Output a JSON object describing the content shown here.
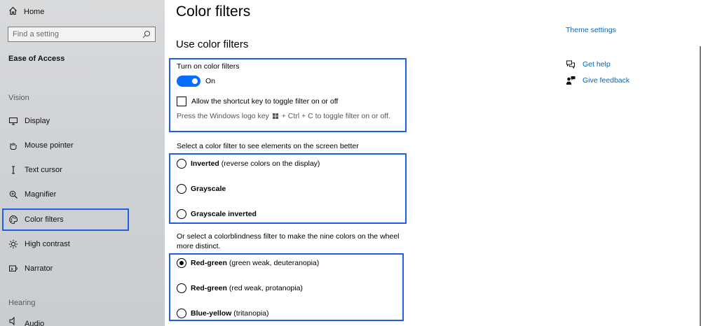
{
  "sidebar": {
    "home_label": "Home",
    "search_placeholder": "Find a setting",
    "section_title": "Ease of Access",
    "group_vision": "Vision",
    "items": [
      {
        "label": "Display",
        "icon": "monitor-icon"
      },
      {
        "label": "Mouse pointer",
        "icon": "mouse-pointer-icon"
      },
      {
        "label": "Text cursor",
        "icon": "text-cursor-icon"
      },
      {
        "label": "Magnifier",
        "icon": "magnifier-icon"
      },
      {
        "label": "Color filters",
        "icon": "palette-icon",
        "active": true
      },
      {
        "label": "High contrast",
        "icon": "sun-icon"
      },
      {
        "label": "Narrator",
        "icon": "narrator-icon"
      }
    ],
    "group_hearing": "Hearing",
    "partial_item": "Audio"
  },
  "main": {
    "title": "Color filters",
    "subtitle": "Use color filters",
    "turn_on_label": "Turn on color filters",
    "toggle_state": "On",
    "shortcut_label": "Allow the shortcut key to toggle filter on or off",
    "hint_prefix": "Press the Windows logo key",
    "hint_suffix": "+ Ctrl + C to toggle filter on or off.",
    "select_filter_label": "Select a color filter to see elements on the screen better",
    "filters": [
      {
        "name": "Inverted",
        "desc": " (reverse colors on the display)",
        "checked": false
      },
      {
        "name": "Grayscale",
        "desc": "",
        "checked": false
      },
      {
        "name": "Grayscale inverted",
        "desc": "",
        "checked": false
      }
    ],
    "colorblind_label_1": "Or select a colorblindness filter to make the nine colors on the wheel",
    "colorblind_label_2": "more distinct.",
    "colorblind_filters": [
      {
        "name": "Red-green",
        "desc": " (green weak, deuteranopia)",
        "checked": true
      },
      {
        "name": "Red-green",
        "desc": " (red weak, protanopia)",
        "checked": false
      },
      {
        "name": "Blue-yellow",
        "desc": " (tritanopia)",
        "checked": false
      }
    ]
  },
  "right_panel": {
    "theme_settings": "Theme settings",
    "get_help": "Get help",
    "give_feedback": "Give feedback"
  },
  "colors": {
    "accent": "#0a6cff",
    "highlight_border": "#1f5fe6",
    "link": "#0067c0"
  }
}
